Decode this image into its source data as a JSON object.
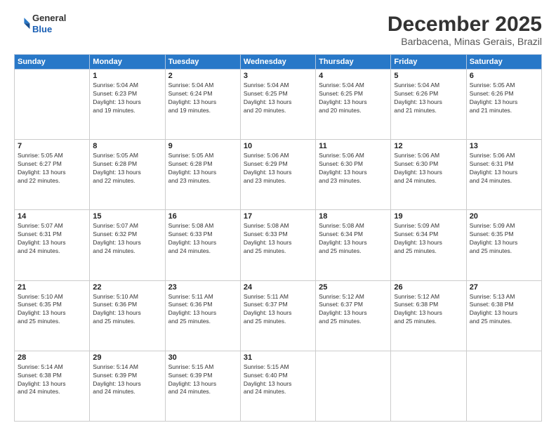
{
  "header": {
    "logo_line1": "General",
    "logo_line2": "Blue",
    "month": "December 2025",
    "location": "Barbacena, Minas Gerais, Brazil"
  },
  "weekdays": [
    "Sunday",
    "Monday",
    "Tuesday",
    "Wednesday",
    "Thursday",
    "Friday",
    "Saturday"
  ],
  "weeks": [
    [
      {
        "day": "",
        "info": ""
      },
      {
        "day": "1",
        "info": "Sunrise: 5:04 AM\nSunset: 6:23 PM\nDaylight: 13 hours\nand 19 minutes."
      },
      {
        "day": "2",
        "info": "Sunrise: 5:04 AM\nSunset: 6:24 PM\nDaylight: 13 hours\nand 19 minutes."
      },
      {
        "day": "3",
        "info": "Sunrise: 5:04 AM\nSunset: 6:25 PM\nDaylight: 13 hours\nand 20 minutes."
      },
      {
        "day": "4",
        "info": "Sunrise: 5:04 AM\nSunset: 6:25 PM\nDaylight: 13 hours\nand 20 minutes."
      },
      {
        "day": "5",
        "info": "Sunrise: 5:04 AM\nSunset: 6:26 PM\nDaylight: 13 hours\nand 21 minutes."
      },
      {
        "day": "6",
        "info": "Sunrise: 5:05 AM\nSunset: 6:26 PM\nDaylight: 13 hours\nand 21 minutes."
      }
    ],
    [
      {
        "day": "7",
        "info": "Sunrise: 5:05 AM\nSunset: 6:27 PM\nDaylight: 13 hours\nand 22 minutes."
      },
      {
        "day": "8",
        "info": "Sunrise: 5:05 AM\nSunset: 6:28 PM\nDaylight: 13 hours\nand 22 minutes."
      },
      {
        "day": "9",
        "info": "Sunrise: 5:05 AM\nSunset: 6:28 PM\nDaylight: 13 hours\nand 23 minutes."
      },
      {
        "day": "10",
        "info": "Sunrise: 5:06 AM\nSunset: 6:29 PM\nDaylight: 13 hours\nand 23 minutes."
      },
      {
        "day": "11",
        "info": "Sunrise: 5:06 AM\nSunset: 6:30 PM\nDaylight: 13 hours\nand 23 minutes."
      },
      {
        "day": "12",
        "info": "Sunrise: 5:06 AM\nSunset: 6:30 PM\nDaylight: 13 hours\nand 24 minutes."
      },
      {
        "day": "13",
        "info": "Sunrise: 5:06 AM\nSunset: 6:31 PM\nDaylight: 13 hours\nand 24 minutes."
      }
    ],
    [
      {
        "day": "14",
        "info": "Sunrise: 5:07 AM\nSunset: 6:31 PM\nDaylight: 13 hours\nand 24 minutes."
      },
      {
        "day": "15",
        "info": "Sunrise: 5:07 AM\nSunset: 6:32 PM\nDaylight: 13 hours\nand 24 minutes."
      },
      {
        "day": "16",
        "info": "Sunrise: 5:08 AM\nSunset: 6:33 PM\nDaylight: 13 hours\nand 24 minutes."
      },
      {
        "day": "17",
        "info": "Sunrise: 5:08 AM\nSunset: 6:33 PM\nDaylight: 13 hours\nand 25 minutes."
      },
      {
        "day": "18",
        "info": "Sunrise: 5:08 AM\nSunset: 6:34 PM\nDaylight: 13 hours\nand 25 minutes."
      },
      {
        "day": "19",
        "info": "Sunrise: 5:09 AM\nSunset: 6:34 PM\nDaylight: 13 hours\nand 25 minutes."
      },
      {
        "day": "20",
        "info": "Sunrise: 5:09 AM\nSunset: 6:35 PM\nDaylight: 13 hours\nand 25 minutes."
      }
    ],
    [
      {
        "day": "21",
        "info": "Sunrise: 5:10 AM\nSunset: 6:35 PM\nDaylight: 13 hours\nand 25 minutes."
      },
      {
        "day": "22",
        "info": "Sunrise: 5:10 AM\nSunset: 6:36 PM\nDaylight: 13 hours\nand 25 minutes."
      },
      {
        "day": "23",
        "info": "Sunrise: 5:11 AM\nSunset: 6:36 PM\nDaylight: 13 hours\nand 25 minutes."
      },
      {
        "day": "24",
        "info": "Sunrise: 5:11 AM\nSunset: 6:37 PM\nDaylight: 13 hours\nand 25 minutes."
      },
      {
        "day": "25",
        "info": "Sunrise: 5:12 AM\nSunset: 6:37 PM\nDaylight: 13 hours\nand 25 minutes."
      },
      {
        "day": "26",
        "info": "Sunrise: 5:12 AM\nSunset: 6:38 PM\nDaylight: 13 hours\nand 25 minutes."
      },
      {
        "day": "27",
        "info": "Sunrise: 5:13 AM\nSunset: 6:38 PM\nDaylight: 13 hours\nand 25 minutes."
      }
    ],
    [
      {
        "day": "28",
        "info": "Sunrise: 5:14 AM\nSunset: 6:38 PM\nDaylight: 13 hours\nand 24 minutes."
      },
      {
        "day": "29",
        "info": "Sunrise: 5:14 AM\nSunset: 6:39 PM\nDaylight: 13 hours\nand 24 minutes."
      },
      {
        "day": "30",
        "info": "Sunrise: 5:15 AM\nSunset: 6:39 PM\nDaylight: 13 hours\nand 24 minutes."
      },
      {
        "day": "31",
        "info": "Sunrise: 5:15 AM\nSunset: 6:40 PM\nDaylight: 13 hours\nand 24 minutes."
      },
      {
        "day": "",
        "info": ""
      },
      {
        "day": "",
        "info": ""
      },
      {
        "day": "",
        "info": ""
      }
    ]
  ]
}
